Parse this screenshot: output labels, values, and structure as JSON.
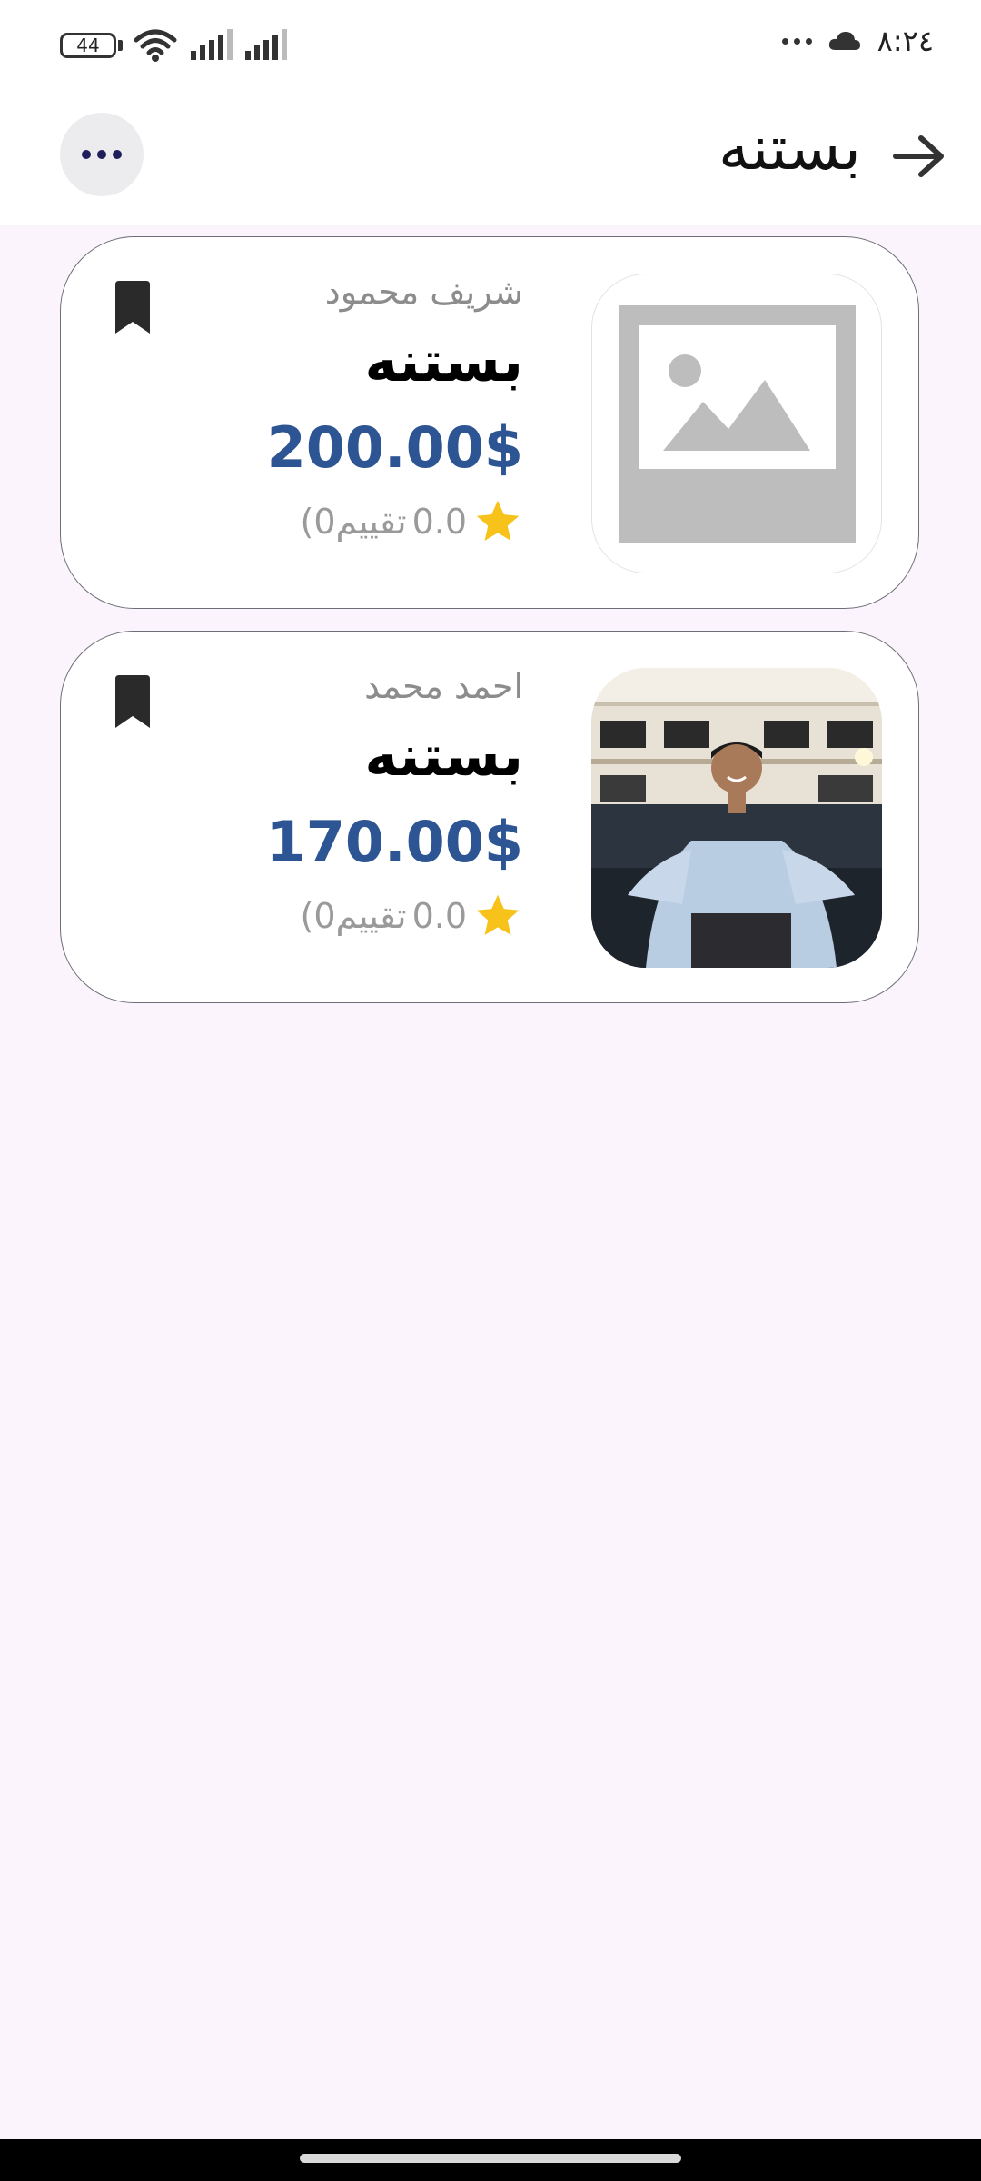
{
  "status_bar": {
    "time": "٨:٢٤",
    "battery_level": "44",
    "icons": [
      "battery-icon",
      "wifi-icon",
      "signal-icon",
      "signal-icon",
      "more-dots-icon",
      "cloud-icon"
    ]
  },
  "app_bar": {
    "title": "بستنه",
    "back_icon": "arrow-forward-icon",
    "menu_icon": "more-horizontal-icon"
  },
  "cards": [
    {
      "author": "شريف محمود",
      "title": "بستنه",
      "price": "200.00$",
      "rating": "0.0",
      "rating_count": "(0تقييم",
      "image": "placeholder-image-icon",
      "bookmark_icon": "bookmark-icon"
    },
    {
      "author": "احمد محمد",
      "title": "بستنه",
      "price": "170.00$",
      "rating": "0.0",
      "rating_count": "(0تقييم",
      "image": "photo",
      "bookmark_icon": "bookmark-icon"
    }
  ],
  "colors": {
    "background": "#fcf4fc",
    "price": "#2e5593",
    "star": "#f7c21a",
    "author": "#8c8c8c"
  }
}
